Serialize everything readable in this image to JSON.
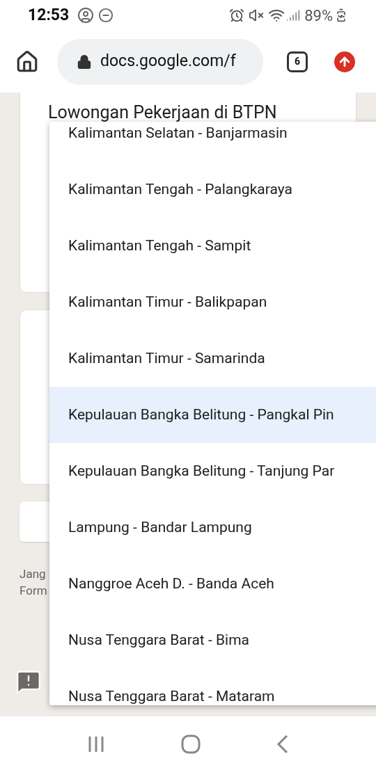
{
  "status_bar": {
    "time": "12:53",
    "battery": "89%"
  },
  "browser": {
    "url": "docs.google.com/f",
    "tab_count": "6"
  },
  "form": {
    "title": "Lowongan Pekerjaan di BTPN",
    "footer_lines": [
      "Jang",
      "Form"
    ]
  },
  "dropdown": {
    "options": [
      {
        "label": "Kalimantan Selatan - Banjarmasin",
        "selected": false
      },
      {
        "label": "Kalimantan Tengah - Palangkaraya",
        "selected": false
      },
      {
        "label": "Kalimantan Tengah - Sampit",
        "selected": false
      },
      {
        "label": "Kalimantan Timur - Balikpapan",
        "selected": false
      },
      {
        "label": "Kalimantan Timur - Samarinda",
        "selected": false
      },
      {
        "label": "Kepulauan Bangka Belitung - Pangkal Pin",
        "selected": true
      },
      {
        "label": "Kepulauan Bangka Belitung - Tanjung Par",
        "selected": false
      },
      {
        "label": "Lampung - Bandar Lampung",
        "selected": false
      },
      {
        "label": "Nanggroe Aceh D. - Banda Aceh",
        "selected": false
      },
      {
        "label": "Nusa Tenggara Barat - Bima",
        "selected": false
      },
      {
        "label": "Nusa Tenggara Barat - Mataram",
        "selected": false
      }
    ]
  }
}
